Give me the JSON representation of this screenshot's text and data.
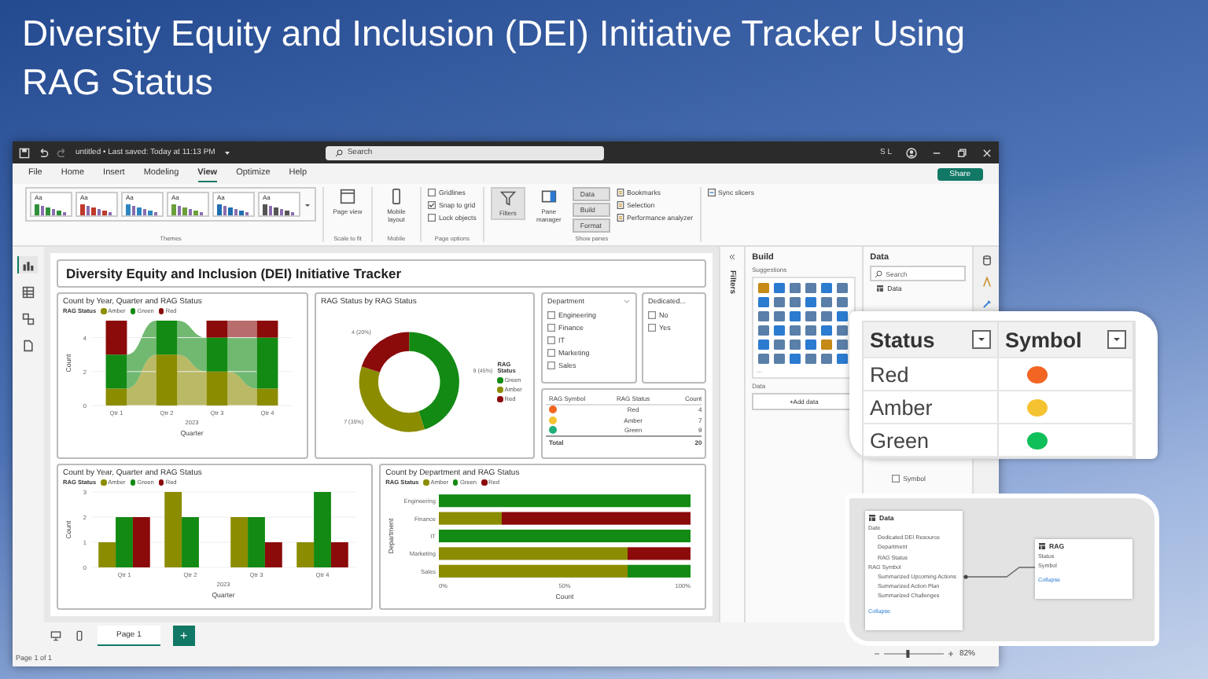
{
  "slide_title": "Diversity Equity and Inclusion (DEI) Initiative Tracker Using RAG Status",
  "window": {
    "file_title": "untitled • Last saved: Today at 11:13 PM",
    "search_placeholder": "Search",
    "user": "S L"
  },
  "menu": [
    {
      "label": "File",
      "selected": false
    },
    {
      "label": "Home",
      "selected": false
    },
    {
      "label": "Insert",
      "selected": false
    },
    {
      "label": "Modeling",
      "selected": false
    },
    {
      "label": "View",
      "selected": true
    },
    {
      "label": "Optimize",
      "selected": false
    },
    {
      "label": "Help",
      "selected": false
    }
  ],
  "share": "Share",
  "ribbon": {
    "themes": [
      {
        "sample": "Aa",
        "color": "#2f8f3a"
      },
      {
        "sample": "Aa",
        "color": "#c0392b"
      },
      {
        "sample": "Aa",
        "color": "#2e86c1"
      },
      {
        "sample": "Aa",
        "color": "#6a9f3a"
      },
      {
        "sample": "Aa",
        "color": "#1f6fb2"
      },
      {
        "sample": "Aa",
        "color": "#555555"
      }
    ],
    "themes_label": "Themes",
    "page_view": "Page view",
    "scale_label": "Scale to fit",
    "mobile_layout": "Mobile layout",
    "mobile_label": "Mobile",
    "page_options": [
      {
        "label": "Gridlines",
        "checked": false
      },
      {
        "label": "Snap to grid",
        "checked": true
      },
      {
        "label": "Lock objects",
        "checked": false
      }
    ],
    "page_options_label": "Page options",
    "filters": {
      "label": "Filters",
      "on": true
    },
    "pane_manager": "Pane manager",
    "panes": [
      {
        "label": "Data",
        "on": true
      },
      {
        "label": "Build",
        "on": true
      },
      {
        "label": "Format",
        "on": true
      }
    ],
    "panes2": [
      "Bookmarks",
      "Selection",
      "Performance analyzer"
    ],
    "show_panes_label": "Show panes",
    "sync_slicers": "Sync slicers"
  },
  "left_nav": [
    {
      "selected": true
    },
    {
      "selected": false
    },
    {
      "selected": false
    },
    {
      "selected": false
    }
  ],
  "report": {
    "title": "Diversity Equity and Inclusion (DEI) Initiative Tracker",
    "ribbon_chart": {
      "legend_title": "RAG Status",
      "period": "2023",
      "chart_data": {
        "type": "bar",
        "title": "Count by Year, Quarter and RAG Status",
        "xlabel": "Quarter",
        "ylabel": "Count",
        "categories": [
          "Qtr 1",
          "Qtr 2",
          "Qtr 3",
          "Qtr 4"
        ],
        "stacked": true,
        "ylim": [
          0,
          5
        ],
        "yticks": [
          0,
          2,
          4
        ],
        "series": [
          {
            "name": "Amber",
            "color": "#8c8c00",
            "values": [
              1,
              3,
              2,
              1
            ]
          },
          {
            "name": "Green",
            "color": "#138a13",
            "values": [
              2,
              2,
              2,
              3
            ]
          },
          {
            "name": "Red",
            "color": "#8b0a0a",
            "values": [
              2,
              0,
              1,
              1
            ]
          }
        ]
      }
    },
    "donut_chart": {
      "legend_title": "RAG Status",
      "legend": [
        {
          "color": "#138a13"
        },
        {
          "color": "#8c8c00"
        },
        {
          "color": "#8b0a0a"
        }
      ],
      "chart_data": {
        "type": "donut",
        "title": "RAG Status by RAG Status",
        "categories": [
          "Green",
          "Amber",
          "Red"
        ],
        "values": [
          9,
          7,
          4
        ],
        "value_labels": [
          "9 (45%)",
          "7 (35%)",
          "4 (20%)"
        ]
      }
    },
    "department_slicer": {
      "title": "Department",
      "items": [
        {
          "label": "Engineering",
          "checked": false
        },
        {
          "label": "Finance",
          "checked": false
        },
        {
          "label": "IT",
          "checked": false
        },
        {
          "label": "Marketing",
          "checked": false
        },
        {
          "label": "Sales",
          "checked": false
        }
      ]
    },
    "dedicated_slicer": {
      "title": "Dedicated...",
      "items": [
        {
          "label": "No",
          "checked": false
        },
        {
          "label": "Yes",
          "checked": false
        }
      ]
    },
    "rag_table": {
      "columns": [
        "RAG Symbol",
        "RAG Status",
        "Count"
      ],
      "rows": [
        {
          "color": "#f26522",
          "status": "Red",
          "count": "4"
        },
        {
          "color": "#f5c232",
          "status": "Amber",
          "count": "7"
        },
        {
          "color": "#1fb07a",
          "status": "Green",
          "count": "9"
        }
      ],
      "total_label": "Total",
      "total": "20"
    },
    "bar_chart": {
      "legend_title": "RAG Status",
      "period": "2023",
      "chart_data": {
        "type": "bar",
        "title": "Count by Year, Quarter and RAG Status",
        "xlabel": "Quarter",
        "ylabel": "Count",
        "categories": [
          "Qtr 1",
          "Qtr 2",
          "Qtr 3",
          "Qtr 4"
        ],
        "ylim": [
          0,
          3
        ],
        "yticks": [
          0,
          1,
          2,
          3
        ],
        "series": [
          {
            "name": "Amber",
            "color": "#8c8c00",
            "values": [
              1,
              3,
              2,
              1
            ]
          },
          {
            "name": "Green",
            "color": "#138a13",
            "values": [
              2,
              2,
              2,
              3
            ]
          },
          {
            "name": "Red",
            "color": "#8b0a0a",
            "values": [
              2,
              0,
              1,
              1
            ]
          }
        ]
      }
    },
    "stacked_chart": {
      "legend_title": "RAG Status",
      "chart_data": {
        "type": "bar",
        "orientation": "horizontal",
        "stacked": true,
        "title": "Count by Department and RAG Status",
        "xlabel": "Count",
        "ylabel": "Department",
        "categories": [
          "Engineering",
          "Finance",
          "IT",
          "Marketing",
          "Sales"
        ],
        "xlim": [
          0,
          100
        ],
        "xticks": [
          {
            "value": 0,
            "label": "0%"
          },
          {
            "value": 50,
            "label": "50%"
          },
          {
            "value": 100,
            "label": "100%"
          }
        ],
        "series": [
          {
            "name": "Amber",
            "color": "#8c8c00",
            "values": [
              0,
              25,
              0,
              75,
              75
            ]
          },
          {
            "name": "Green",
            "color": "#138a13",
            "values": [
              100,
              0,
              100,
              0,
              25
            ]
          },
          {
            "name": "Red",
            "color": "#8b0a0a",
            "values": [
              0,
              75,
              0,
              25,
              0
            ]
          }
        ]
      }
    }
  },
  "page_tabs": [
    {
      "label": "Page 1",
      "selected": true
    }
  ],
  "add_page": "+",
  "status": "Page 1 of 1",
  "filters_pane": "Filters",
  "build_pane": {
    "title": "Build",
    "suggestions": "Suggestions",
    "more": "...",
    "data_label": "Data",
    "add_data": "+Add data"
  },
  "data_pane": {
    "title": "Data",
    "search_placeholder": "Search",
    "tree_root": "Data",
    "field": {
      "label": "Symbol",
      "checked": false
    }
  },
  "status_overlay": {
    "columns": [
      "Status",
      "Symbol"
    ],
    "rows": [
      {
        "status": "Red",
        "color": "#f26522"
      },
      {
        "status": "Amber",
        "color": "#f5c232"
      },
      {
        "status": "Green",
        "color": "#0fc05a"
      }
    ]
  },
  "model_overlay": {
    "tables": [
      {
        "name": "Data",
        "fields": [
          {
            "label": "Date",
            "children": [
              {
                "label": "Dedicated DEI Resource"
              },
              {
                "label": "Department"
              },
              {
                "label": "RAG Status"
              }
            ]
          },
          {
            "label": "RAG Symbol",
            "children": [
              {
                "label": "Summarized Upcoming Actions"
              },
              {
                "label": "Summarized Action Plan"
              },
              {
                "label": "Summarized Challenges"
              }
            ]
          }
        ],
        "collapse": "Collapse"
      },
      {
        "name": "RAG",
        "fields": [
          {
            "label": "Status"
          },
          {
            "label": "Symbol"
          }
        ],
        "collapse": "Collapse"
      }
    ],
    "zoom_slider": {
      "level": 0.4
    },
    "zoom": "82%"
  }
}
